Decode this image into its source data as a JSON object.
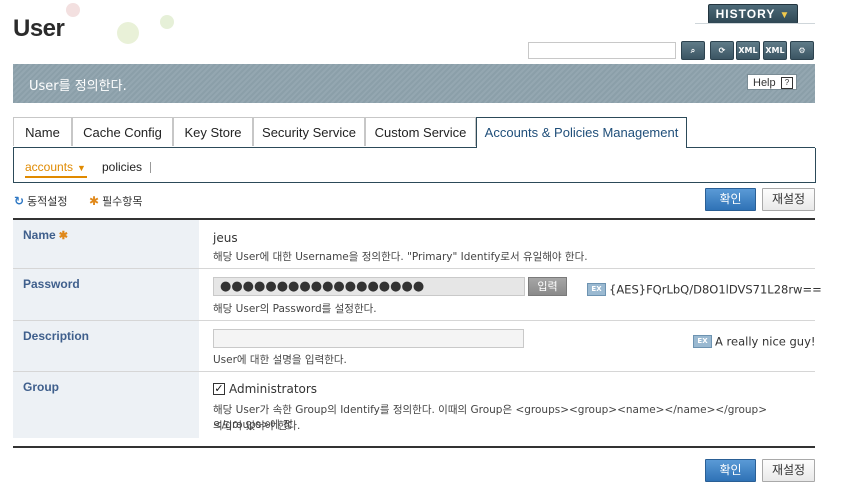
{
  "header": {
    "title": "User",
    "history_label": "HISTORY",
    "search_placeholder": ""
  },
  "toolbar": {
    "buttons": [
      {
        "name": "search-icon",
        "glyph": "🔍"
      },
      {
        "name": "refresh-icon",
        "glyph": "⟳"
      },
      {
        "name": "xml-export-icon",
        "glyph": "XML"
      },
      {
        "name": "xml-import-icon",
        "glyph": "XML"
      },
      {
        "name": "page-settings-icon",
        "glyph": "⚙"
      }
    ]
  },
  "banner": {
    "text": "User를 정의한다.",
    "help_label": "Help",
    "help_icon": "?"
  },
  "tabs": [
    {
      "label": "Name"
    },
    {
      "label": "Cache Config"
    },
    {
      "label": "Key Store"
    },
    {
      "label": "Security Service"
    },
    {
      "label": "Custom Service"
    },
    {
      "label": "Accounts & Policies Management",
      "active": true
    }
  ],
  "subnav": {
    "accounts": "accounts",
    "policies": "policies"
  },
  "legend": {
    "dynamic": "동적설정",
    "required": "필수항목"
  },
  "actions": {
    "ok": "확인",
    "reset": "재설정"
  },
  "form": {
    "name": {
      "label": "Name",
      "value": "jeus",
      "desc": "해당 User에 대한 Username을 정의한다. \"Primary\" Identify로서 유일해야 한다."
    },
    "password": {
      "label": "Password",
      "value": "●●●●●●●●●●●●●●●●●●",
      "encrypt_label": "입력",
      "example_badge": "EX",
      "example": "{AES}FQrLbQ/D8O1lDVS71L28rw==",
      "desc": "해당 User의 Password를 설정한다."
    },
    "description": {
      "label": "Description",
      "value": "",
      "example_badge": "EX",
      "example": "A really nice guy!",
      "desc": "User에 대한 설명을 입력한다."
    },
    "group": {
      "label": "Group",
      "checkbox_label": "Administrators",
      "checked": true,
      "desc_line1": "해당 User가 속한 Group의 Identify를 정의한다. 이때의 Group은 <groups><group><name></name></group></groups>에 정",
      "desc_line2": "의되어 있어야 한다."
    }
  },
  "colors": {
    "accent": "#2f72b6",
    "tab_border": "#2c4a59",
    "label_blue": "#3f5f8c",
    "required_orange": "#e0891b"
  }
}
